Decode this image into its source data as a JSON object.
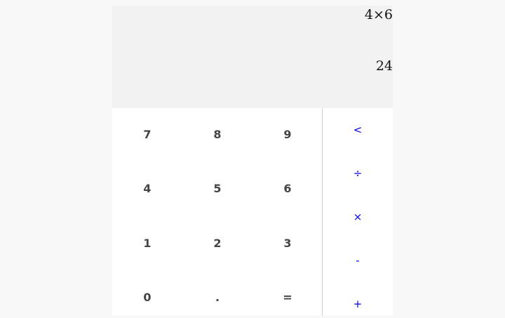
{
  "display": {
    "expression": "4×6",
    "result": "24"
  },
  "keypad": {
    "rows": [
      [
        "7",
        "8",
        "9"
      ],
      [
        "4",
        "5",
        "6"
      ],
      [
        "1",
        "2",
        "3"
      ],
      [
        "0",
        ".",
        "="
      ]
    ]
  },
  "operators": {
    "backspace": "<",
    "divide": "÷",
    "multiply": "×",
    "subtract": "-",
    "add": "+"
  },
  "colors": {
    "display_bg": "#f2f2f2",
    "digit_text": "#444444",
    "operator_text": "#0000ee"
  }
}
